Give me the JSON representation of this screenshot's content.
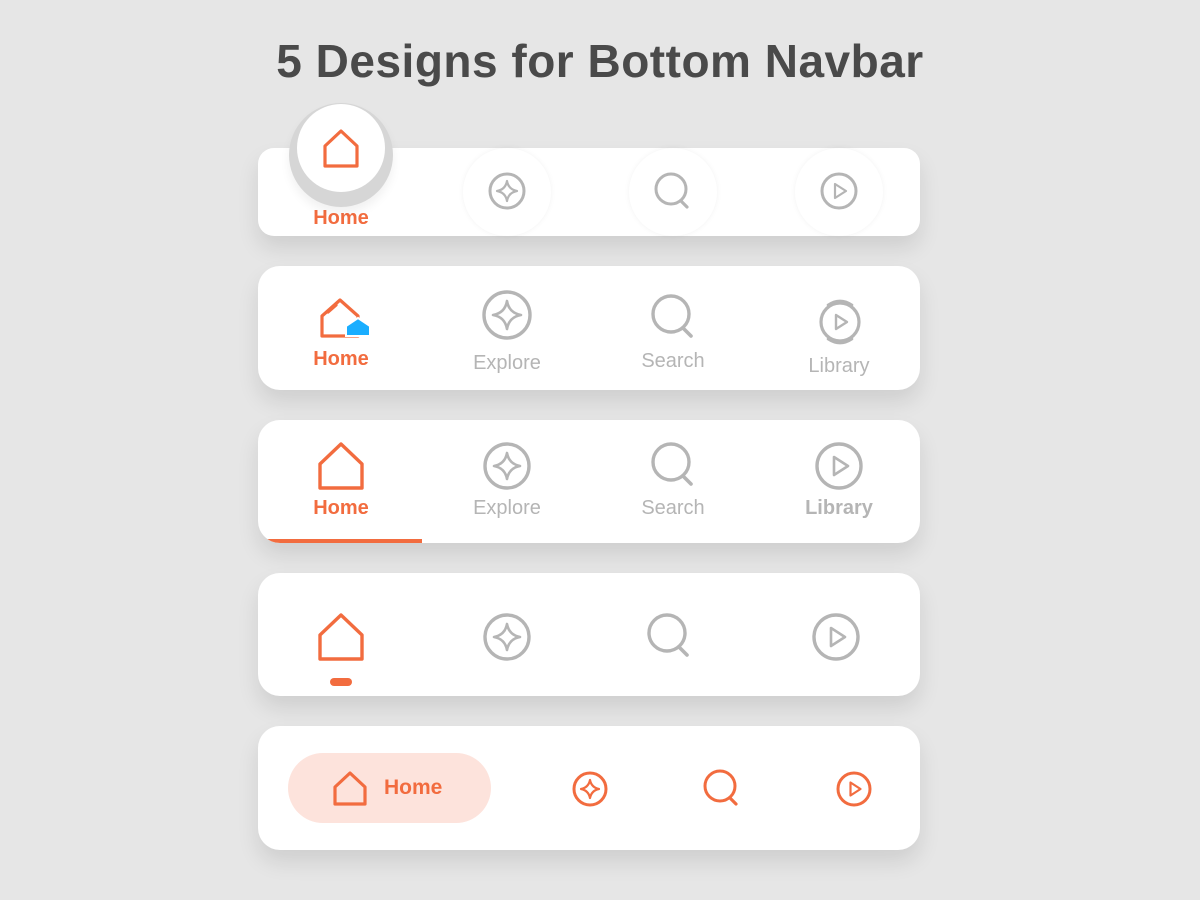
{
  "title": "5 Designs for Bottom Navbar",
  "colors": {
    "background": "#e6e6e6",
    "accent": "#f26c3f",
    "inactive": "#b5b5b5",
    "accent_light": "#fde3dc",
    "badge": "#1aaeff"
  },
  "navbars": [
    {
      "style": "floating-bubble",
      "active_label": "Home",
      "items": [
        {
          "icon": "home-icon"
        },
        {
          "icon": "explore-icon"
        },
        {
          "icon": "search-icon"
        },
        {
          "icon": "library-icon"
        }
      ]
    },
    {
      "style": "labels-with-badge",
      "items": [
        {
          "icon": "home-icon",
          "label": "Home"
        },
        {
          "icon": "explore-icon",
          "label": "Explore"
        },
        {
          "icon": "search-icon",
          "label": "Search"
        },
        {
          "icon": "library-icon",
          "label": "Library"
        }
      ]
    },
    {
      "style": "labels-with-underline",
      "items": [
        {
          "icon": "home-icon",
          "label": "Home"
        },
        {
          "icon": "explore-icon",
          "label": "Explore"
        },
        {
          "icon": "search-icon",
          "label": "Search"
        },
        {
          "icon": "library-icon",
          "label": "Library"
        }
      ]
    },
    {
      "style": "icons-with-dot",
      "items": [
        {
          "icon": "home-icon"
        },
        {
          "icon": "explore-icon"
        },
        {
          "icon": "search-icon"
        },
        {
          "icon": "library-icon"
        }
      ]
    },
    {
      "style": "pill",
      "active_label": "Home",
      "items": [
        {
          "icon": "home-icon"
        },
        {
          "icon": "explore-icon"
        },
        {
          "icon": "search-icon"
        },
        {
          "icon": "library-icon"
        }
      ]
    }
  ]
}
